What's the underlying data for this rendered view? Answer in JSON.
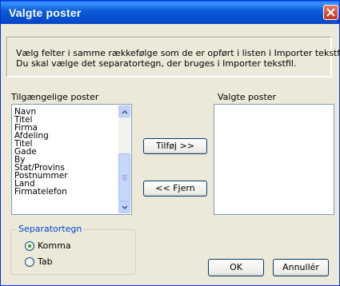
{
  "window": {
    "title": "Valgte poster"
  },
  "info": {
    "line1": "Vælg felter i samme rækkefølge som de er opført i listen i Importer tekstfil.",
    "line2": "Du skal vælge det separatortegn, der bruges i Importer tekstfil."
  },
  "available": {
    "label": "Tilgængelige poster",
    "items": [
      "Navn",
      "Titel",
      "Firma",
      "Afdeling",
      "Titel",
      "Gade",
      "By",
      "Stat/Provins",
      "Postnummer",
      "Land",
      "Firmatelefon"
    ]
  },
  "selected": {
    "label": "Valgte poster",
    "items": []
  },
  "buttons": {
    "add": "Tilføj >>",
    "remove": "<< Fjern",
    "ok": "OK",
    "cancel": "Annullér"
  },
  "separator": {
    "legend": "Separatortegn",
    "options": [
      {
        "label": "Komma",
        "checked": true
      },
      {
        "label": "Tab",
        "checked": false
      }
    ]
  },
  "colors": {
    "accent_green": "#21a121",
    "groupbox_title": "#0046d5"
  }
}
